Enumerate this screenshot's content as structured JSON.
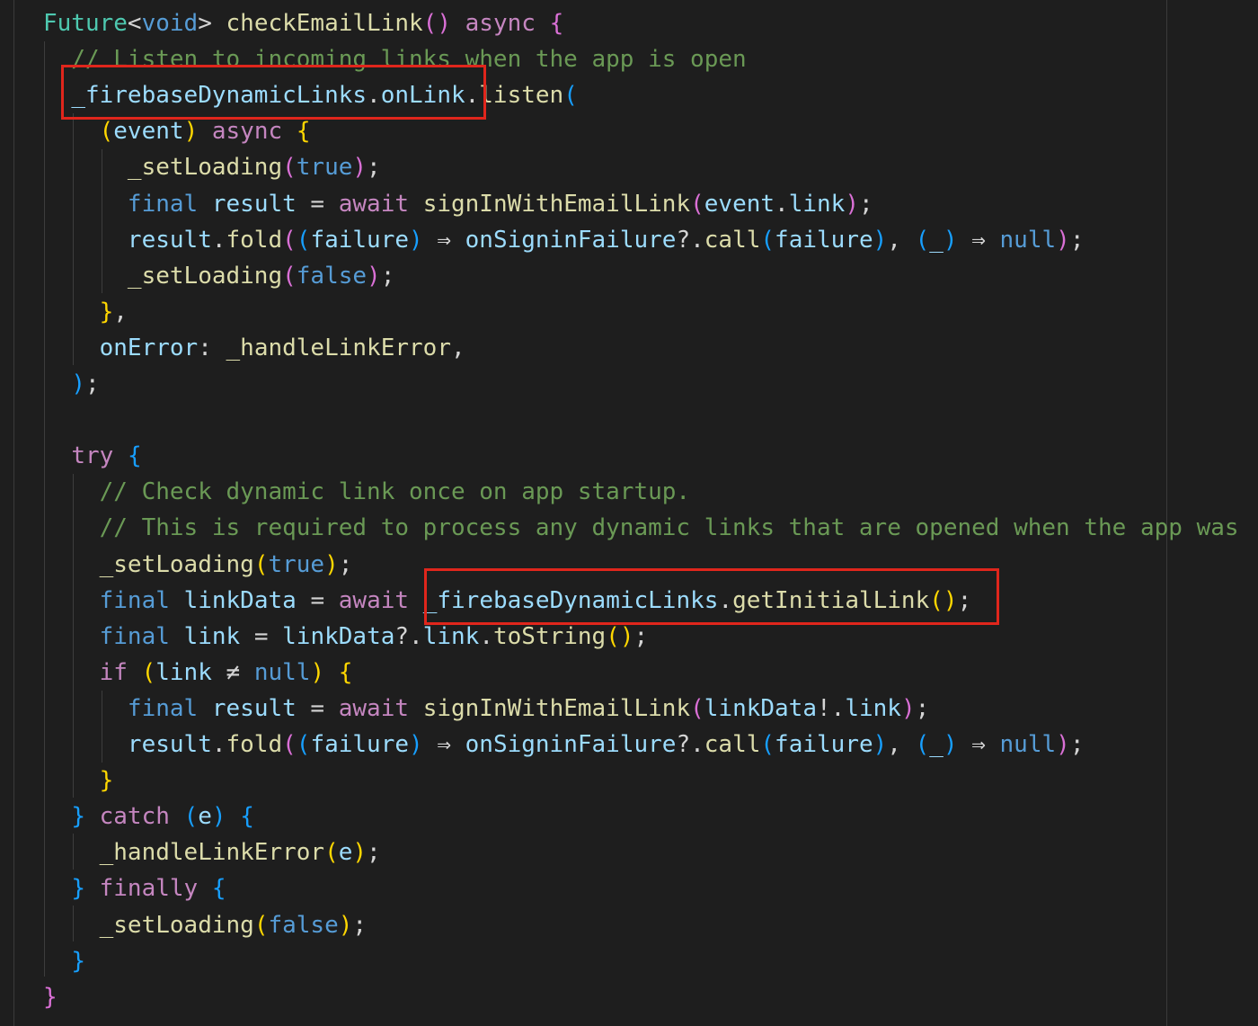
{
  "code_lines": [
    [
      [
        "type",
        "Future"
      ],
      [
        "pun",
        "<"
      ],
      [
        "key",
        "void"
      ],
      [
        "pun",
        "> "
      ],
      [
        "fn",
        "checkEmailLink"
      ],
      [
        "b2",
        "()"
      ],
      [
        "pun",
        " "
      ],
      [
        "kw",
        "async"
      ],
      [
        "pun",
        " "
      ],
      [
        "b2",
        "{"
      ]
    ],
    [
      [
        "pun",
        "  "
      ],
      [
        "com",
        "// Listen to incoming links when the app is open"
      ]
    ],
    [
      [
        "pun",
        "  "
      ],
      [
        "var",
        "_firebaseDynamicLinks"
      ],
      [
        "pun",
        "."
      ],
      [
        "var",
        "onLink"
      ],
      [
        "pun",
        "."
      ],
      [
        "fn",
        "listen"
      ],
      [
        "b3",
        "("
      ]
    ],
    [
      [
        "pun",
        "    "
      ],
      [
        "b1",
        "("
      ],
      [
        "var",
        "event"
      ],
      [
        "b1",
        ")"
      ],
      [
        "pun",
        " "
      ],
      [
        "kw",
        "async"
      ],
      [
        "pun",
        " "
      ],
      [
        "b1",
        "{"
      ]
    ],
    [
      [
        "pun",
        "      "
      ],
      [
        "fn",
        "_setLoading"
      ],
      [
        "b2",
        "("
      ],
      [
        "key",
        "true"
      ],
      [
        "b2",
        ")"
      ],
      [
        "pun",
        ";"
      ]
    ],
    [
      [
        "pun",
        "      "
      ],
      [
        "key",
        "final"
      ],
      [
        "pun",
        " "
      ],
      [
        "var",
        "result"
      ],
      [
        "pun",
        " = "
      ],
      [
        "kw",
        "await"
      ],
      [
        "pun",
        " "
      ],
      [
        "fn",
        "signInWithEmailLink"
      ],
      [
        "b2",
        "("
      ],
      [
        "var",
        "event"
      ],
      [
        "pun",
        "."
      ],
      [
        "var",
        "link"
      ],
      [
        "b2",
        ")"
      ],
      [
        "pun",
        ";"
      ]
    ],
    [
      [
        "pun",
        "      "
      ],
      [
        "var",
        "result"
      ],
      [
        "pun",
        "."
      ],
      [
        "fn",
        "fold"
      ],
      [
        "b2",
        "("
      ],
      [
        "b3",
        "("
      ],
      [
        "var",
        "failure"
      ],
      [
        "b3",
        ")"
      ],
      [
        "pun",
        " ⇒ "
      ],
      [
        "var",
        "onSigninFailure"
      ],
      [
        "pun",
        "?."
      ],
      [
        "fn",
        "call"
      ],
      [
        "b3",
        "("
      ],
      [
        "var",
        "failure"
      ],
      [
        "b3",
        ")"
      ],
      [
        "pun",
        ", "
      ],
      [
        "b3",
        "("
      ],
      [
        "var",
        "_"
      ],
      [
        "b3",
        ")"
      ],
      [
        "pun",
        " ⇒ "
      ],
      [
        "key",
        "null"
      ],
      [
        "b2",
        ")"
      ],
      [
        "pun",
        ";"
      ]
    ],
    [
      [
        "pun",
        "      "
      ],
      [
        "fn",
        "_setLoading"
      ],
      [
        "b2",
        "("
      ],
      [
        "key",
        "false"
      ],
      [
        "b2",
        ")"
      ],
      [
        "pun",
        ";"
      ]
    ],
    [
      [
        "pun",
        "    "
      ],
      [
        "b1",
        "}"
      ],
      [
        "pun",
        ","
      ]
    ],
    [
      [
        "pun",
        "    "
      ],
      [
        "var",
        "onError"
      ],
      [
        "pun",
        ": "
      ],
      [
        "fn",
        "_handleLinkError"
      ],
      [
        "pun",
        ","
      ]
    ],
    [
      [
        "pun",
        "  "
      ],
      [
        "b3",
        ")"
      ],
      [
        "pun",
        ";"
      ]
    ],
    [],
    [
      [
        "pun",
        "  "
      ],
      [
        "kw",
        "try"
      ],
      [
        "pun",
        " "
      ],
      [
        "b3",
        "{"
      ]
    ],
    [
      [
        "pun",
        "    "
      ],
      [
        "com",
        "// Check dynamic link once on app startup."
      ]
    ],
    [
      [
        "pun",
        "    "
      ],
      [
        "com",
        "// This is required to process any dynamic links that are opened when the app was"
      ]
    ],
    [
      [
        "pun",
        "    "
      ],
      [
        "fn",
        "_setLoading"
      ],
      [
        "b1",
        "("
      ],
      [
        "key",
        "true"
      ],
      [
        "b1",
        ")"
      ],
      [
        "pun",
        ";"
      ]
    ],
    [
      [
        "pun",
        "    "
      ],
      [
        "key",
        "final"
      ],
      [
        "pun",
        " "
      ],
      [
        "var",
        "linkData"
      ],
      [
        "pun",
        " = "
      ],
      [
        "kw",
        "await"
      ],
      [
        "pun",
        " "
      ],
      [
        "var",
        "_firebaseDynamicLinks"
      ],
      [
        "pun",
        "."
      ],
      [
        "fn",
        "getInitialLink"
      ],
      [
        "b1",
        "()"
      ],
      [
        "pun",
        ";"
      ]
    ],
    [
      [
        "pun",
        "    "
      ],
      [
        "key",
        "final"
      ],
      [
        "pun",
        " "
      ],
      [
        "var",
        "link"
      ],
      [
        "pun",
        " = "
      ],
      [
        "var",
        "linkData"
      ],
      [
        "pun",
        "?."
      ],
      [
        "var",
        "link"
      ],
      [
        "pun",
        "."
      ],
      [
        "fn",
        "toString"
      ],
      [
        "b1",
        "()"
      ],
      [
        "pun",
        ";"
      ]
    ],
    [
      [
        "pun",
        "    "
      ],
      [
        "kw",
        "if"
      ],
      [
        "pun",
        " "
      ],
      [
        "b1",
        "("
      ],
      [
        "var",
        "link"
      ],
      [
        "pun",
        " ≠ "
      ],
      [
        "key",
        "null"
      ],
      [
        "b1",
        ")"
      ],
      [
        "pun",
        " "
      ],
      [
        "b1",
        "{"
      ]
    ],
    [
      [
        "pun",
        "      "
      ],
      [
        "key",
        "final"
      ],
      [
        "pun",
        " "
      ],
      [
        "var",
        "result"
      ],
      [
        "pun",
        " = "
      ],
      [
        "kw",
        "await"
      ],
      [
        "pun",
        " "
      ],
      [
        "fn",
        "signInWithEmailLink"
      ],
      [
        "b2",
        "("
      ],
      [
        "var",
        "linkData"
      ],
      [
        "pun",
        "!."
      ],
      [
        "var",
        "link"
      ],
      [
        "b2",
        ")"
      ],
      [
        "pun",
        ";"
      ]
    ],
    [
      [
        "pun",
        "      "
      ],
      [
        "var",
        "result"
      ],
      [
        "pun",
        "."
      ],
      [
        "fn",
        "fold"
      ],
      [
        "b2",
        "("
      ],
      [
        "b3",
        "("
      ],
      [
        "var",
        "failure"
      ],
      [
        "b3",
        ")"
      ],
      [
        "pun",
        " ⇒ "
      ],
      [
        "var",
        "onSigninFailure"
      ],
      [
        "pun",
        "?."
      ],
      [
        "fn",
        "call"
      ],
      [
        "b3",
        "("
      ],
      [
        "var",
        "failure"
      ],
      [
        "b3",
        ")"
      ],
      [
        "pun",
        ", "
      ],
      [
        "b3",
        "("
      ],
      [
        "var",
        "_"
      ],
      [
        "b3",
        ")"
      ],
      [
        "pun",
        " ⇒ "
      ],
      [
        "key",
        "null"
      ],
      [
        "b2",
        ")"
      ],
      [
        "pun",
        ";"
      ]
    ],
    [
      [
        "pun",
        "    "
      ],
      [
        "b1",
        "}"
      ]
    ],
    [
      [
        "pun",
        "  "
      ],
      [
        "b3",
        "}"
      ],
      [
        "pun",
        " "
      ],
      [
        "kw",
        "catch"
      ],
      [
        "pun",
        " "
      ],
      [
        "b3",
        "("
      ],
      [
        "var",
        "e"
      ],
      [
        "b3",
        ")"
      ],
      [
        "pun",
        " "
      ],
      [
        "b3",
        "{"
      ]
    ],
    [
      [
        "pun",
        "    "
      ],
      [
        "fn",
        "_handleLinkError"
      ],
      [
        "b1",
        "("
      ],
      [
        "var",
        "e"
      ],
      [
        "b1",
        ")"
      ],
      [
        "pun",
        ";"
      ]
    ],
    [
      [
        "pun",
        "  "
      ],
      [
        "b3",
        "}"
      ],
      [
        "pun",
        " "
      ],
      [
        "kw",
        "finally"
      ],
      [
        "pun",
        " "
      ],
      [
        "b3",
        "{"
      ]
    ],
    [
      [
        "pun",
        "    "
      ],
      [
        "fn",
        "_setLoading"
      ],
      [
        "b1",
        "("
      ],
      [
        "key",
        "false"
      ],
      [
        "b1",
        ")"
      ],
      [
        "pun",
        ";"
      ]
    ],
    [
      [
        "pun",
        "  "
      ],
      [
        "b3",
        "}"
      ]
    ],
    [
      [
        "b2",
        "}"
      ]
    ]
  ],
  "highlights": [
    "onLink listener",
    "getInitialLink call"
  ],
  "colors": {
    "background": "#1e1e1e",
    "type": "#4ec9b0",
    "keyword_control": "#c586c0",
    "keyword": "#569cd6",
    "function": "#dcdcaa",
    "variable": "#9cdcfe",
    "comment": "#6a9955",
    "bracket_1": "#ffd700",
    "bracket_2": "#da70d6",
    "bracket_3": "#179fff",
    "highlight_box": "#e0261c"
  }
}
